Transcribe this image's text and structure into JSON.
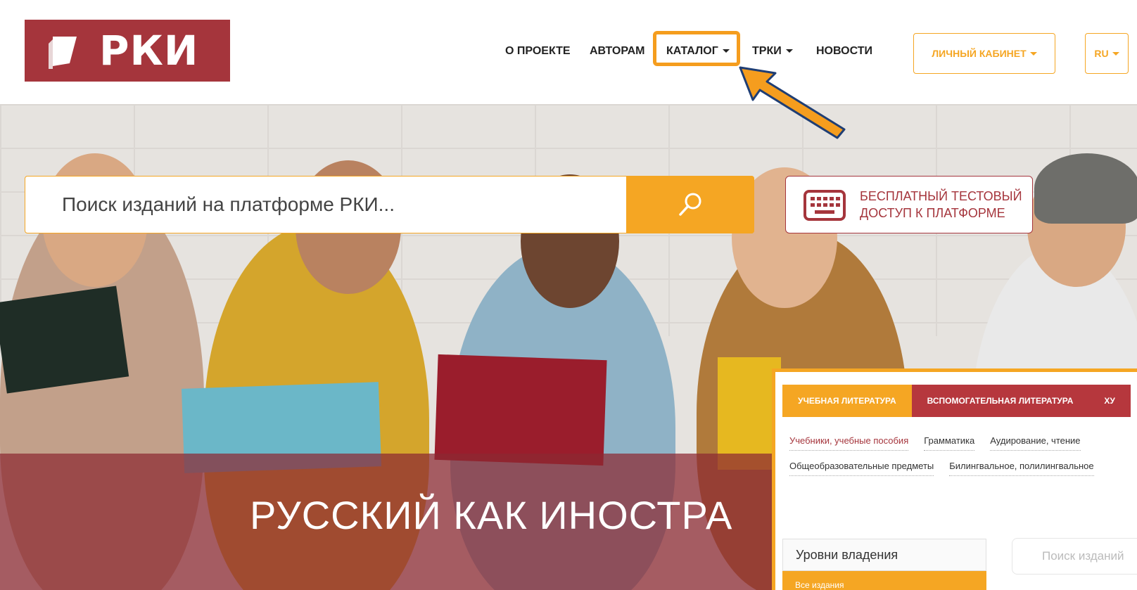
{
  "logo": {
    "text": "РКИ"
  },
  "nav": {
    "about": "О ПРОЕКТЕ",
    "authors": "АВТОРАМ",
    "catalog": "КАТАЛОГ",
    "trki": "ТРКИ",
    "news": "НОВОСТИ"
  },
  "account": {
    "cabinet_label": "ЛИЧНЫЙ КАБИНЕТ",
    "lang_label": "RU"
  },
  "search": {
    "placeholder": "Поиск изданий на платформе РКИ..."
  },
  "free_access": {
    "line1": "БЕСПЛАТНЫЙ ТЕСТОВЫЙ",
    "line2": "ДОСТУП К ПЛАТФОРМЕ"
  },
  "hero": {
    "title": "РУССКИЙ КАК ИНОСТРА"
  },
  "catalog_panel": {
    "tabs": [
      "УЧЕБНАЯ ЛИТЕРАТУРА",
      "ВСПОМОГАТЕЛЬНАЯ ЛИТЕРАТУРА",
      "ХУ"
    ],
    "row1": [
      "Учебники, учебные пособия",
      "Грамматика",
      "Аудирование, чтение"
    ],
    "row2": [
      "Общеобразовательные предметы",
      "Билингвальное, полилингвальное"
    ],
    "levels_label": "Уровни владения",
    "all_editions": "Все издания",
    "search_placeholder": "Поиск изданий"
  },
  "colors": {
    "brand": "#a5353c",
    "accent": "#f5a623"
  },
  "icons": [
    "search-icon",
    "keyboard-icon",
    "pointer-arrow"
  ]
}
